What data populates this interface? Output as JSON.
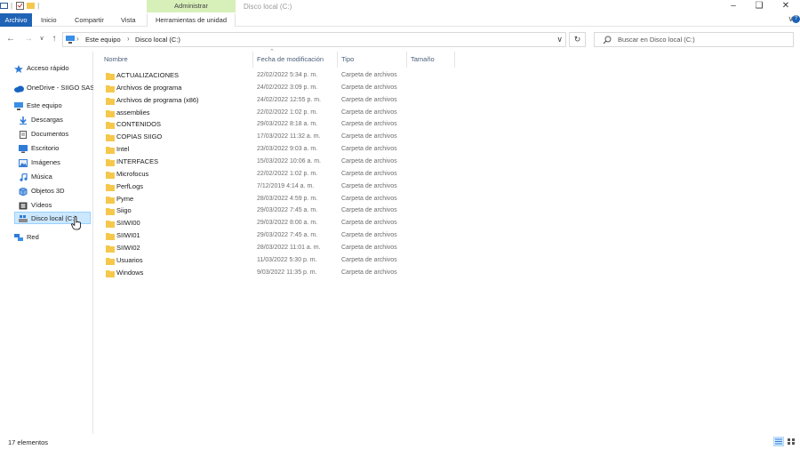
{
  "window": {
    "title": "Disco local (C:)",
    "manage_label": "Administrar"
  },
  "ribbon": {
    "tabs": [
      "Archivo",
      "Inicio",
      "Compartir",
      "Vista",
      "Herramientas de unidad"
    ]
  },
  "address": {
    "crumbs": [
      "Este equipo",
      "Disco local (C:)"
    ]
  },
  "search": {
    "placeholder": "Buscar en Disco local (C:)"
  },
  "nav": {
    "items": [
      {
        "label": "Acceso rápido",
        "icon": "star-icon"
      },
      {
        "label": "OneDrive - SIIGO SAS",
        "icon": "cloud-icon"
      },
      {
        "label": "Este equipo",
        "icon": "computer-icon"
      },
      {
        "label": "Descargas",
        "icon": "download-icon"
      },
      {
        "label": "Documentos",
        "icon": "document-icon"
      },
      {
        "label": "Escritorio",
        "icon": "desktop-icon"
      },
      {
        "label": "Imágenes",
        "icon": "image-icon"
      },
      {
        "label": "Música",
        "icon": "music-icon"
      },
      {
        "label": "Objetos 3D",
        "icon": "cube-icon"
      },
      {
        "label": "Vídeos",
        "icon": "video-icon"
      },
      {
        "label": "Disco local (C:)",
        "icon": "drive-icon",
        "selected": true
      },
      {
        "label": "Red",
        "icon": "network-icon"
      }
    ]
  },
  "columns": [
    "Nombre",
    "Fecha de modificación",
    "Tipo",
    "Tamaño"
  ],
  "files": [
    {
      "name": "ACTUALIZACIONES",
      "date": "22/02/2022 5:34 p. m.",
      "type": "Carpeta de archivos"
    },
    {
      "name": "Archivos de programa",
      "date": "24/02/2022 3:09 p. m.",
      "type": "Carpeta de archivos"
    },
    {
      "name": "Archivos de programa (x86)",
      "date": "24/02/2022 12:55 p. m.",
      "type": "Carpeta de archivos"
    },
    {
      "name": "assemblies",
      "date": "22/02/2022 1:02 p. m.",
      "type": "Carpeta de archivos"
    },
    {
      "name": "CONTENIDOS",
      "date": "29/03/2022 8:18 a. m.",
      "type": "Carpeta de archivos"
    },
    {
      "name": "COPIAS SIIGO",
      "date": "17/03/2022 11:32 a. m.",
      "type": "Carpeta de archivos"
    },
    {
      "name": "Intel",
      "date": "23/03/2022 9:03 a. m.",
      "type": "Carpeta de archivos"
    },
    {
      "name": "INTERFACES",
      "date": "15/03/2022 10:06 a. m.",
      "type": "Carpeta de archivos"
    },
    {
      "name": "Microfocus",
      "date": "22/02/2022 1:02 p. m.",
      "type": "Carpeta de archivos"
    },
    {
      "name": "PerfLogs",
      "date": "7/12/2019 4:14 a. m.",
      "type": "Carpeta de archivos"
    },
    {
      "name": "Pyme",
      "date": "28/03/2022 4:59 p. m.",
      "type": "Carpeta de archivos"
    },
    {
      "name": "Siigo",
      "date": "29/03/2022 7:45 a. m.",
      "type": "Carpeta de archivos"
    },
    {
      "name": "SIIWI00",
      "date": "29/03/2022 8:00 a. m.",
      "type": "Carpeta de archivos"
    },
    {
      "name": "SIIWI01",
      "date": "29/03/2022 7:45 a. m.",
      "type": "Carpeta de archivos"
    },
    {
      "name": "SIIWI02",
      "date": "28/03/2022 11:01 a. m.",
      "type": "Carpeta de archivos"
    },
    {
      "name": "Usuarios",
      "date": "11/03/2022 5:30 p. m.",
      "type": "Carpeta de archivos"
    },
    {
      "name": "Windows",
      "date": "9/03/2022 11:35 p. m.",
      "type": "Carpeta de archivos"
    }
  ],
  "status": {
    "count": "17 elementos"
  },
  "colors": {
    "accent": "#1e63b6",
    "manage_tab": "#d7efb8",
    "selection": "#cce8ff",
    "folder": "#f5c84c"
  }
}
